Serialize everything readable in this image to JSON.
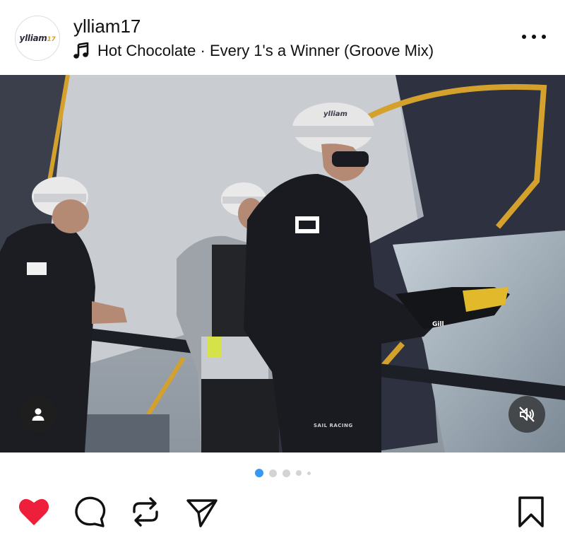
{
  "post": {
    "username": "ylliam17",
    "avatar_logo_text": "ylliam",
    "avatar_logo_number": "17",
    "music": "Hot Chocolate · Every 1's a Winner (Groove Mix)"
  },
  "photo": {
    "helmet_brand": "ylliam",
    "sleeve_brand": "Gill",
    "trouser_brand": "SAIL RACING"
  },
  "carousel": {
    "count": 5,
    "active_index": 0
  },
  "icons": {
    "more": "more-options-icon",
    "music": "music-note-icon",
    "tag": "user-tag-icon",
    "mute": "muted-speaker-icon",
    "like": "heart-icon",
    "comment": "comment-icon",
    "repost": "repost-icon",
    "share": "share-icon",
    "save": "bookmark-icon"
  },
  "colors": {
    "like_active": "#ed1f3b",
    "dot_active": "#3897f0",
    "dot_inactive": "#d4d4d4"
  }
}
